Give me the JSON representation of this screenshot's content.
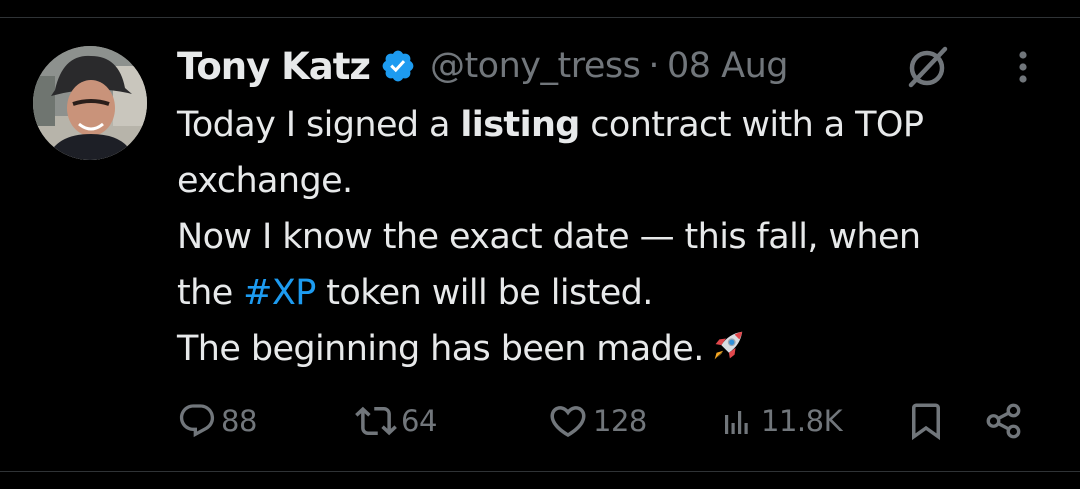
{
  "tweet": {
    "author": {
      "name": "Tony Katz",
      "handle": "@tony_tress",
      "verified": true,
      "avatar_icon": "profile-photo-icon"
    },
    "separator": "·",
    "date": "08 Aug",
    "text": {
      "line1_pre": "Today I signed a ",
      "line1_bold": "listing",
      "line1_post": " contract with a TOP",
      "line2": "exchange.",
      "line3": "Now I know the exact date — this fall, when",
      "line4_pre": "the ",
      "line4_hashtag": "#XP",
      "line4_post": " token will be listed.",
      "line5": "The beginning has been made.",
      "emoji": "rocket-icon"
    },
    "actions": {
      "replies": "88",
      "reposts": "64",
      "likes": "128",
      "views": "11.8K"
    }
  },
  "colors": {
    "background": "#000000",
    "text": "#e7e9ea",
    "secondary": "#71767b",
    "accent": "#1d9bf0",
    "divider": "#2f3336"
  },
  "icons": [
    "verified-badge-icon",
    "grok-icon",
    "more-options-icon",
    "reply-icon",
    "repost-icon",
    "like-icon",
    "views-icon",
    "bookmark-icon",
    "share-icon"
  ]
}
